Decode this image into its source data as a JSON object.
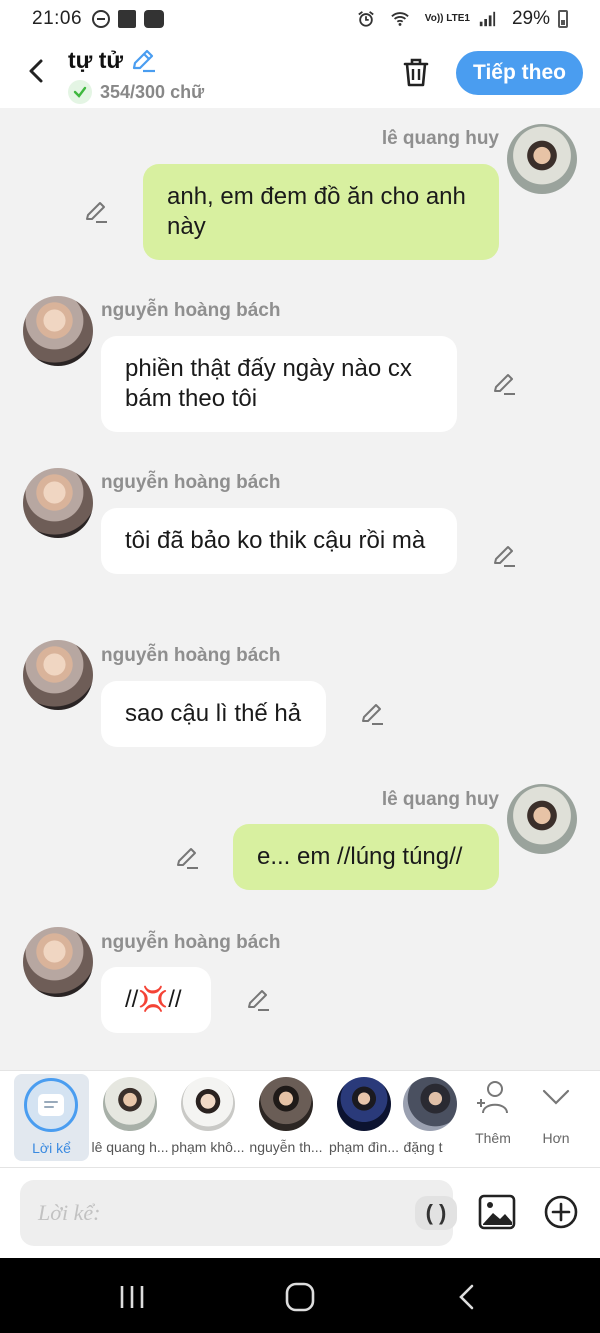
{
  "status_bar": {
    "time": "21:06",
    "network": "Vo)) LTE1",
    "battery": "29%"
  },
  "header": {
    "title": "tự tử",
    "counter": "354/300 chữ",
    "next_label": "Tiếp theo"
  },
  "messages": [
    {
      "side": "right",
      "sender": "lê quang huy",
      "text": "anh, em đem đồ ăn cho anh này"
    },
    {
      "side": "left",
      "sender": "nguyễn hoàng bách",
      "text": "phiền thật đấy ngày nào cx bám theo tôi"
    },
    {
      "side": "left",
      "sender": "nguyễn hoàng bách",
      "text": "tôi đã bảo ko thik cậu rồi mà"
    },
    {
      "side": "left",
      "sender": "nguyễn hoàng bách",
      "text": "sao cậu lì thế hả"
    },
    {
      "side": "right",
      "sender": "lê quang huy",
      "text": "e... em //lúng túng//"
    },
    {
      "side": "left",
      "sender": "nguyễn hoàng bách",
      "text": "//💢//"
    }
  ],
  "picker": {
    "narrator_label": "Lời kể",
    "characters": [
      {
        "name": "lê quang h..."
      },
      {
        "name": "phạm khô..."
      },
      {
        "name": "nguyễn th..."
      },
      {
        "name": "phạm đìn..."
      },
      {
        "name": "đặng t"
      }
    ],
    "add_label": "Thêm",
    "more_label": "Hơn"
  },
  "input": {
    "placeholder": "Lời kể:",
    "paren_label": "( )"
  },
  "colors": {
    "accent": "#4a9df0",
    "bubble_right": "#d8f0a0",
    "bubble_left": "#ffffff",
    "background": "#f2f2f2"
  }
}
